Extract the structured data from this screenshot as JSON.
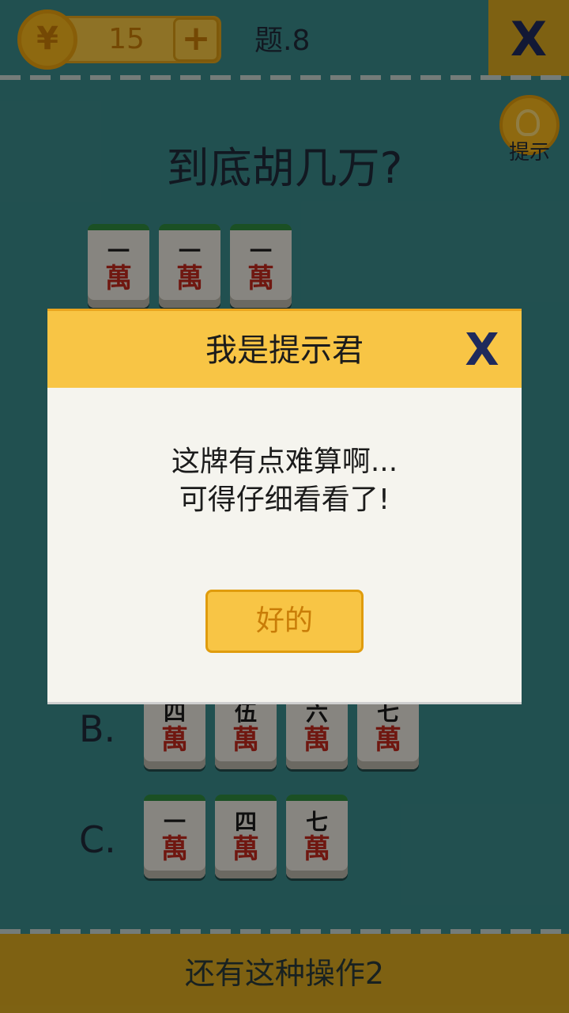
{
  "header": {
    "coin_symbol": "¥",
    "coin_count": "15",
    "plus_label": "+",
    "level": "题.8",
    "exit_label": "X"
  },
  "hint": {
    "label": "提示",
    "icon": "lightbulb-icon"
  },
  "question": "到底胡几万?",
  "hand_tiles": [
    {
      "num": "一",
      "suit": "萬"
    },
    {
      "num": "一",
      "suit": "萬"
    },
    {
      "num": "一",
      "suit": "萬"
    }
  ],
  "options": [
    {
      "label": "B.",
      "tiles": [
        {
          "num": "四",
          "suit": "萬"
        },
        {
          "num": "伍",
          "suit": "萬"
        },
        {
          "num": "六",
          "suit": "萬"
        },
        {
          "num": "七",
          "suit": "萬"
        }
      ]
    },
    {
      "label": "C.",
      "tiles": [
        {
          "num": "一",
          "suit": "萬"
        },
        {
          "num": "四",
          "suit": "萬"
        },
        {
          "num": "七",
          "suit": "萬"
        }
      ]
    }
  ],
  "bottom_bar": {
    "label": "还有这种操作2"
  },
  "dialog": {
    "title": "我是提示君",
    "close_label": "X",
    "message_line1": "这牌有点难算啊...",
    "message_line2": "可得仔细看看了!",
    "ok_label": "好的"
  },
  "colors": {
    "background": "#3a8a8a",
    "gold": "#f8c545",
    "tile_back": "#2f8a3e",
    "wan_red": "#c0281d",
    "dialog_bg": "#f5f4ee"
  }
}
